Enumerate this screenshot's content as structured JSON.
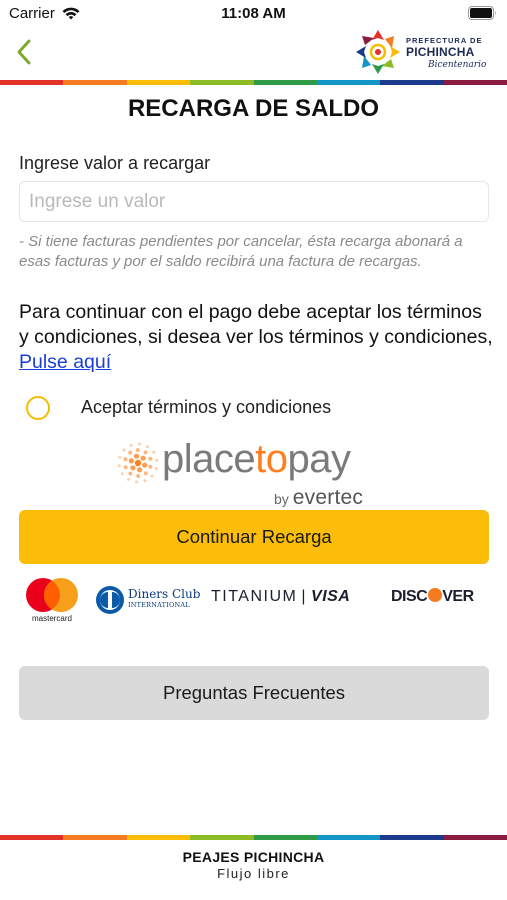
{
  "status_bar": {
    "carrier": "Carrier",
    "time": "11:08 AM"
  },
  "header": {
    "logo_line1": "PREFECTURA DE",
    "logo_line2": "PICHINCHA",
    "logo_line3": "Bicentenario"
  },
  "strip_colors": [
    "#e4322b",
    "#f47b20",
    "#fbbd08",
    "#8dbb25",
    "#2f9a48",
    "#1496c4",
    "#1b3a8c",
    "#8a1d3f"
  ],
  "page": {
    "title": "RECARGA DE SALDO",
    "field_label": "Ingrese valor a recargar",
    "input_value": "",
    "input_placeholder": "Ingrese un valor",
    "note": "- Si tiene facturas pendientes por cancelar, ésta recarga abonará a esas facturas y por el saldo recibirá una factura de recargas.",
    "terms_text": "Para continuar con el pago debe aceptar los términos y condiciones, si desea ver los términos y condiciones, ",
    "terms_link": "Pulse aquí",
    "accept_label": "Aceptar términos y condiciones",
    "accept_checked": false
  },
  "payment": {
    "brand_prefix": "place",
    "brand_mid": "to",
    "brand_suffix": "pay",
    "brand_by": "by",
    "brand_by_company": "evertec",
    "continue_label": "Continuar Recarga",
    "cards": {
      "mastercard": "mastercard",
      "diners_name": "Diners Club",
      "diners_sub": "INTERNATIONAL",
      "titanium": "TITANIUM",
      "titanium_sep": "|",
      "visa": "VISA",
      "discover_pre": "DISC",
      "discover_post": "VER"
    }
  },
  "faq": {
    "label": "Preguntas Frecuentes"
  },
  "footer": {
    "title": "PEAJES PICHINCHA",
    "subtitle": "Flujo libre"
  },
  "colors": {
    "accent": "#fbbd08",
    "back_arrow": "#7aa82a",
    "link": "#1a3fd6",
    "secondary_button": "#dadada"
  }
}
